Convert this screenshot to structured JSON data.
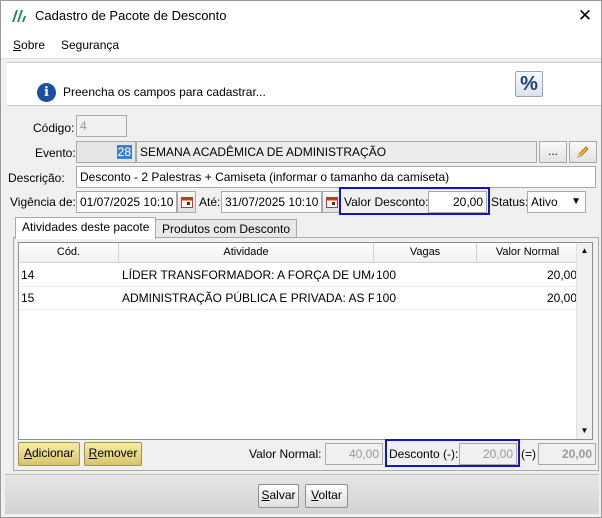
{
  "window": {
    "title": "Cadastro de Pacote de Desconto",
    "close": "✕"
  },
  "menu": {
    "sobre": {
      "ul": "S",
      "rest": "obre"
    },
    "seguranca": "Segurança"
  },
  "info": {
    "icon": "i",
    "text": "Preencha os campos para cadastrar...",
    "percent": "%"
  },
  "form": {
    "codigo_label": "Código:",
    "codigo_value": "4",
    "evento_label": "Evento:",
    "evento_id": "28",
    "evento_name": "SEMANA ACADÊMICA DE ADMINISTRAÇÃO",
    "evento_browse": "...",
    "descricao_label": "Descrição:",
    "descricao_value": "Desconto - 2 Palestras + Camiseta (informar o tamanho da camiseta)",
    "vigencia_label": "Vigência de:",
    "vigencia_de": "01/07/2025 10:10",
    "ate_label": "Até:",
    "vigencia_ate": "31/07/2025 10:10",
    "valor_desconto_label": "Valor Desconto:",
    "valor_desconto": "20,00",
    "status_label": "Status:",
    "status_value": "Ativo"
  },
  "tabs": [
    {
      "label": "Atividades deste pacote"
    },
    {
      "label": "Produtos com Desconto"
    }
  ],
  "grid": {
    "columns": [
      "Cód.",
      "Atividade",
      "Vagas",
      "Valor Normal"
    ],
    "rows": [
      {
        "cod": "14",
        "atividade": "LÍDER TRANSFORMADOR: A FORÇA DE UMA ...",
        "vagas": "100",
        "valor": "20,00"
      },
      {
        "cod": "15",
        "atividade": "ADMINISTRAÇÃO PÚBLICA E PRIVADA: AS P...",
        "vagas": "100",
        "valor": "20,00"
      }
    ]
  },
  "actions": {
    "adicionar": {
      "ul": "A",
      "rest": "dicionar"
    },
    "remover": {
      "ul": "R",
      "rest": "emover"
    }
  },
  "totals": {
    "valor_normal_label": "Valor Normal:",
    "valor_normal": "40,00",
    "desconto_label": "Desconto (-):",
    "desconto": "20,00",
    "igual_label": "(=)",
    "total": "20,00"
  },
  "footer": {
    "salvar": {
      "ul": "S",
      "rest": "alvar"
    },
    "voltar": {
      "ul": "V",
      "rest": "oltar"
    }
  },
  "colors": {
    "highlight_box": "#1515c8",
    "selection": "#3f7fd0",
    "gold_button": "#d7c46a"
  }
}
